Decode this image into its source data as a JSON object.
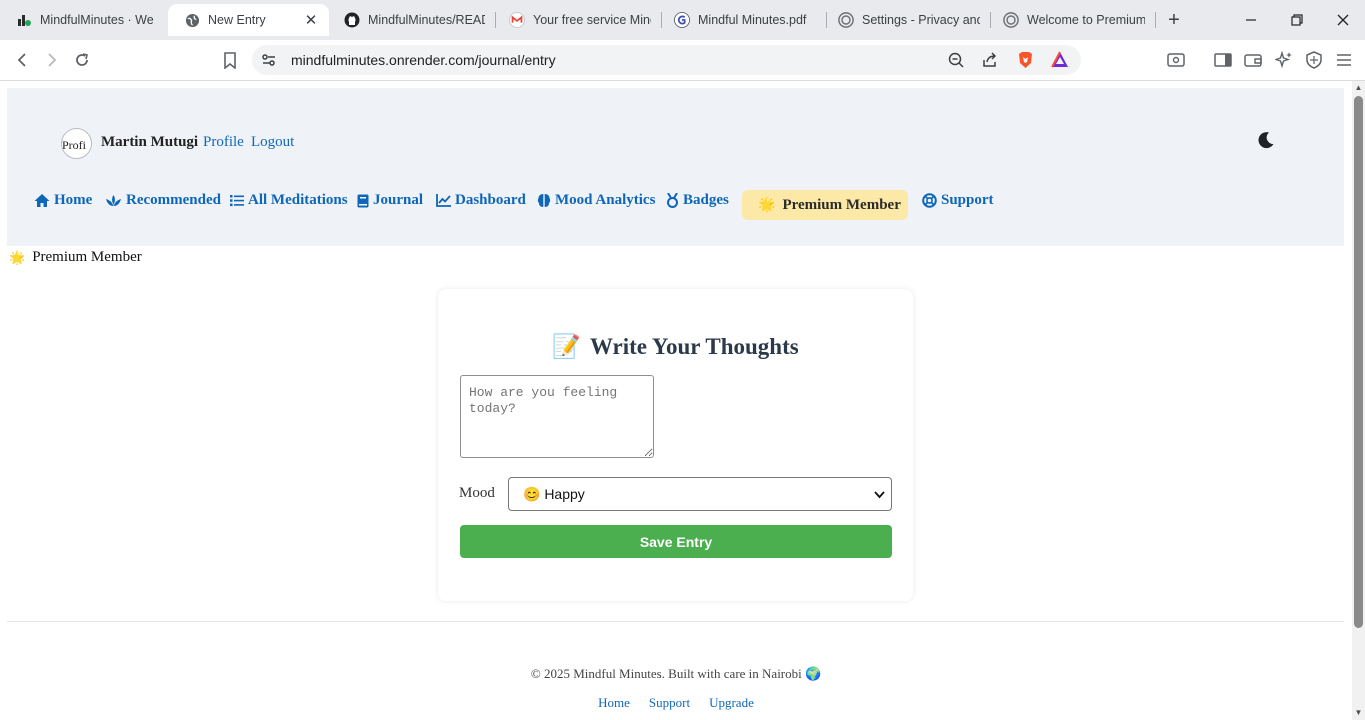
{
  "browser": {
    "tabs": [
      {
        "title": "MindfulMinutes · We",
        "icon": "mindfulminutes-favicon",
        "active": false
      },
      {
        "title": "New Entry",
        "icon": "globe-icon",
        "active": true
      },
      {
        "title": "MindfulMinutes/READ",
        "icon": "github-icon",
        "active": false
      },
      {
        "title": "Your free service Minc",
        "icon": "gmail-icon",
        "active": false
      },
      {
        "title": "Mindful Minutes.pdf",
        "icon": "pdf-icon",
        "active": false
      },
      {
        "title": "Settings - Privacy and",
        "icon": "openai-icon",
        "active": false
      },
      {
        "title": "Welcome to Premium",
        "icon": "openai-icon",
        "active": false
      }
    ],
    "url": "mindfulminutes.onrender.com/journal/entry"
  },
  "header": {
    "avatar_alt": "Profi",
    "username": "Martin Mutugi",
    "profile_link": "Profile",
    "logout_link": "Logout"
  },
  "nav": {
    "items": [
      {
        "label": "Home",
        "icon": "home-icon"
      },
      {
        "label": "Recommended",
        "icon": "lotus-icon"
      },
      {
        "label": "All Meditations",
        "icon": "list-icon"
      },
      {
        "label": "Journal",
        "icon": "book-icon"
      },
      {
        "label": "Dashboard",
        "icon": "line-chart-icon"
      },
      {
        "label": "Mood Analytics",
        "icon": "brain-icon"
      },
      {
        "label": "Badges",
        "icon": "medal-icon"
      },
      {
        "label": "Support",
        "icon": "lifebuoy-icon"
      }
    ],
    "premium_label": "Premium Member",
    "premium_icon": "🌟"
  },
  "status": {
    "premium_text": "Premium Member",
    "premium_icon": "🌟"
  },
  "journal": {
    "title": "Write Your Thoughts",
    "title_icon": "📝",
    "textarea_placeholder": "How are you feeling today?",
    "mood_label": "Mood",
    "mood_selected": "😊 Happy",
    "save_label": "Save Entry"
  },
  "footer": {
    "copyright": "© 2025 Mindful Minutes. Built with care in Nairobi 🌍",
    "links": [
      "Home",
      "Support",
      "Upgrade"
    ]
  },
  "colors": {
    "link": "#1168b9",
    "header_bg": "#eff2f6",
    "premium_pill": "#fde9a7",
    "save_button": "#4bae4f"
  }
}
